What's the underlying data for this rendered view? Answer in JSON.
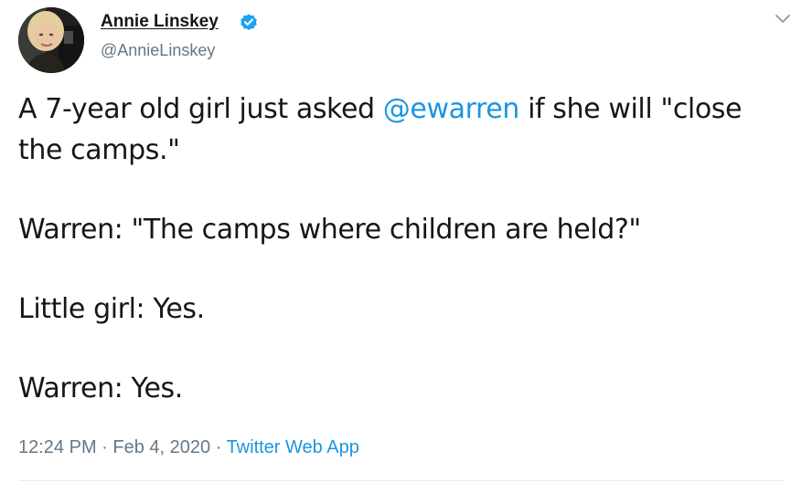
{
  "author": {
    "display_name": "Annie Linskey",
    "handle": "@AnnieLinskey",
    "verified": true,
    "avatar_icon": "user-avatar-photo",
    "verified_icon": "verified-badge-icon"
  },
  "menu": {
    "caret_icon": "chevron-down-icon"
  },
  "tweet": {
    "line1_before": "A 7-year old girl just asked ",
    "line1_mention": "@ewarren",
    "line1_after": " if she will \"close",
    "line2": "the camps.\"",
    "line3": "Warren: \"The camps where children are held?\"",
    "line4": "Little girl: Yes.",
    "line5": "Warren: Yes."
  },
  "meta": {
    "time": "12:24 PM",
    "sep1": " · ",
    "date": "Feb 4, 2020",
    "sep2": " · ",
    "source": "Twitter Web App"
  },
  "colors": {
    "link": "#1b95e0",
    "secondary_text": "#657786",
    "verified_badge": "#1da1f2",
    "divider": "#e6ecf0"
  }
}
